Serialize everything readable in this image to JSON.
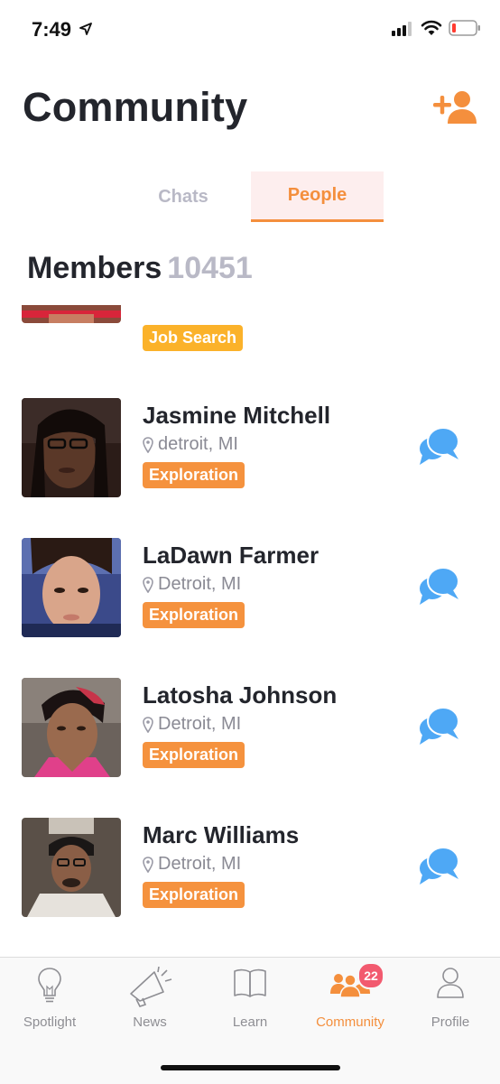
{
  "status_bar": {
    "time": "7:49"
  },
  "header": {
    "title": "Community"
  },
  "segments": {
    "chats": "Chats",
    "people": "People"
  },
  "members": {
    "label": "Members",
    "count": "10451"
  },
  "partial_member": {
    "tag": "Job Search"
  },
  "list": [
    {
      "name": "Jasmine Mitchell",
      "location": "detroit, MI",
      "tag": "Exploration"
    },
    {
      "name": "LaDawn Farmer",
      "location": "Detroit, MI",
      "tag": "Exploration"
    },
    {
      "name": "Latosha Johnson",
      "location": "Detroit, MI",
      "tag": "Exploration"
    },
    {
      "name": "Marc Williams",
      "location": "Detroit, MI",
      "tag": "Exploration"
    }
  ],
  "tabs": [
    {
      "label": "Spotlight",
      "icon": "lightbulb-icon"
    },
    {
      "label": "News",
      "icon": "megaphone-icon"
    },
    {
      "label": "Learn",
      "icon": "book-icon"
    },
    {
      "label": "Community",
      "icon": "people-icon",
      "badge": "22",
      "active": true
    },
    {
      "label": "Profile",
      "icon": "person-icon"
    }
  ],
  "colors": {
    "accent": "#f48f3d",
    "chat_blue": "#4ea8f5",
    "badge": "#f25a6f",
    "tag_yellow": "#fbb22a"
  }
}
